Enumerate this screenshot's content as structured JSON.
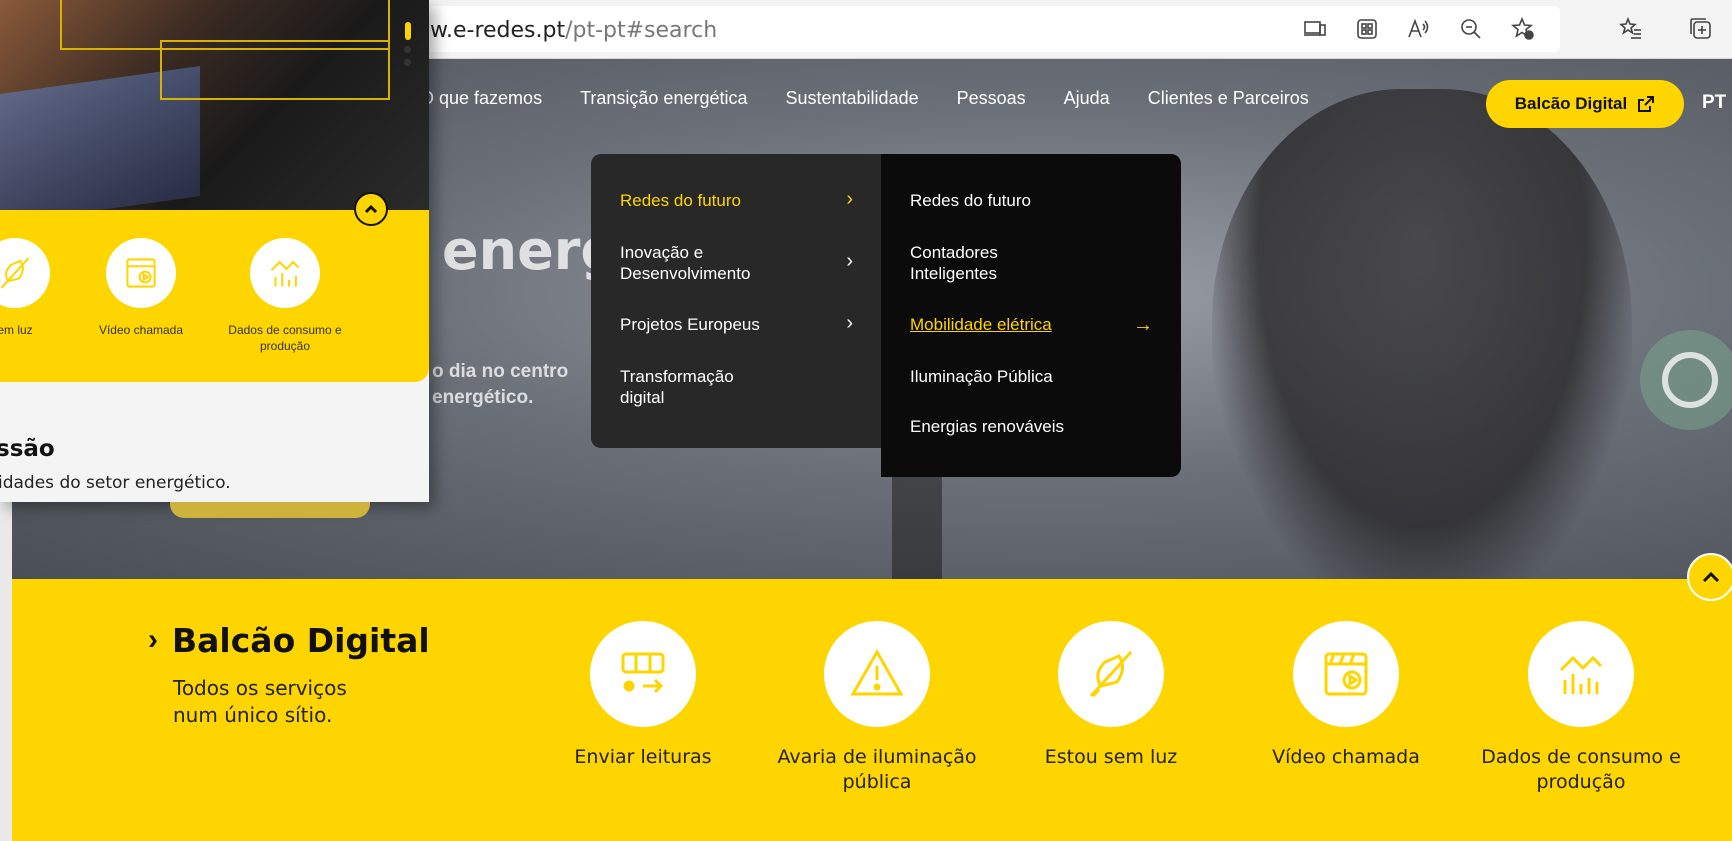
{
  "browser": {
    "url_host": "w.e-redes.pt",
    "url_path": "/pt-pt#search",
    "icons": [
      "device-icon",
      "apps-icon",
      "read-aloud-icon",
      "zoom-out-icon",
      "add-favorite-icon",
      "favorites-icon",
      "collections-icon"
    ]
  },
  "nav": {
    "items": [
      "O que fazemos",
      "Transição energética",
      "Sustentabilidade",
      "Pessoas",
      "Ajuda",
      "Clientes e Parceiros"
    ],
    "cta_label": "Balcão Digital",
    "language": "PT"
  },
  "hero": {
    "heading_fragment": "energ",
    "sub_line1": "o dia no centro",
    "sub_line2": "energético."
  },
  "mega_menu": {
    "left": [
      {
        "label": "Redes do futuro",
        "active": true
      },
      {
        "label": "Inovação e Desenvolvimento",
        "active": false
      },
      {
        "label": "Projetos Europeus",
        "active": false
      },
      {
        "label": "Transformação digital",
        "active": false
      }
    ],
    "right": [
      {
        "label": "Redes do futuro",
        "active": false
      },
      {
        "label": "Contadores Inteligentes",
        "active": false
      },
      {
        "label": "Mobilidade elétrica",
        "active": true
      },
      {
        "label": "Iluminação Pública",
        "active": false
      },
      {
        "label": "Energias renováveis",
        "active": false
      }
    ]
  },
  "balcao": {
    "title": "Balcão Digital",
    "subtitle": "Todos os serviços num único sítio.",
    "services": [
      {
        "label": "Enviar leituras",
        "icon": "meter-reading-icon"
      },
      {
        "label": "Avaria de iluminação pública",
        "icon": "warning-icon"
      },
      {
        "label": "Estou sem luz",
        "icon": "no-power-icon"
      },
      {
        "label": "Vídeo chamada",
        "icon": "video-call-icon"
      },
      {
        "label": "Dados de consumo e produção",
        "icon": "consumption-chart-icon"
      }
    ]
  },
  "overlay": {
    "services": [
      {
        "label": "em luz",
        "icon": "no-power-icon"
      },
      {
        "label": "Vídeo chamada",
        "icon": "video-call-icon"
      },
      {
        "label": "Dados de consumo e produção",
        "icon": "consumption-chart-icon"
      }
    ],
    "title": "ssão",
    "desc": "idades do setor energético."
  },
  "colors": {
    "brand_yellow": "#ffd500",
    "menu_dark": "#282828",
    "menu_black": "#0b0b0b"
  }
}
